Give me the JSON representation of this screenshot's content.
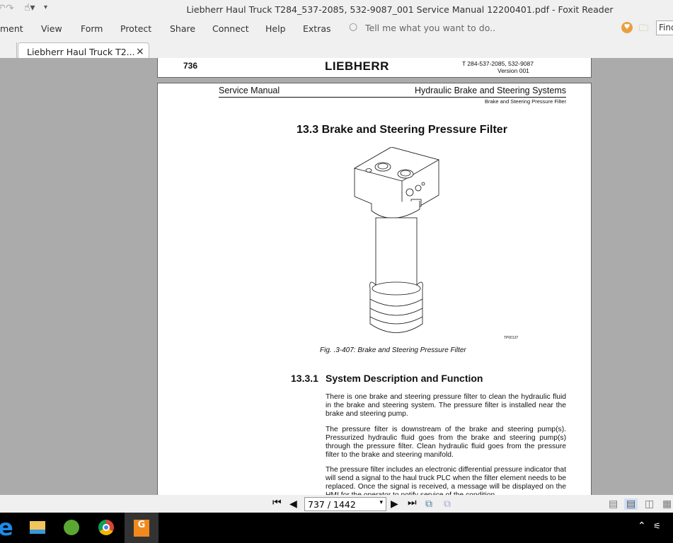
{
  "window": {
    "title": "Liebherr Haul Truck T284_537-2085, 532-9087_001 Service Manual 12200401.pdf - Foxit Reader"
  },
  "menu": [
    "ment",
    "View",
    "Form",
    "Protect",
    "Share",
    "Connect",
    "Help",
    "Extras"
  ],
  "tell_me_placeholder": "Tell me what you want to do..",
  "find_placeholder": "Find",
  "tab": {
    "label": "Liebherr Haul Truck T2...",
    "close": "×"
  },
  "prev_page": {
    "number": "736",
    "logo": "LIEBHERR",
    "model": "T 284-537-2085, 532-9087",
    "version": "Version 001"
  },
  "page": {
    "header_left": "Service Manual",
    "header_right": "Hydraulic Brake and Steering Systems",
    "header_sub": "Brake and Steering Pressure Filter",
    "section_title": "13.3  Brake and Steering Pressure Filter",
    "figure_code": "TP00137",
    "figure_caption": "Fig. .3-407: Brake and Steering Pressure Filter",
    "subsection_number": "13.3.1",
    "subsection_title": "System Description and Function",
    "paragraphs": [
      "There is one brake and steering pressure filter to clean the hydraulic fluid in the brake and steering system. The pressure filter is installed near the brake and steering pump.",
      "The pressure filter is downstream of the brake and steering pump(s). Pressurized hydraulic fluid goes from the brake and steering pump(s) through the pressure filter. Clean hydraulic fluid goes from the pressure filter to the brake and steering manifold.",
      "The pressure filter includes an electronic differential pressure indicator that will send a signal to the haul truck PLC when the filter element needs to be replaced. Once the signal is received, a message will be displayed on the HMI for the operator to notify service of the condition."
    ]
  },
  "navigation": {
    "page_field": "737 / 1442"
  }
}
